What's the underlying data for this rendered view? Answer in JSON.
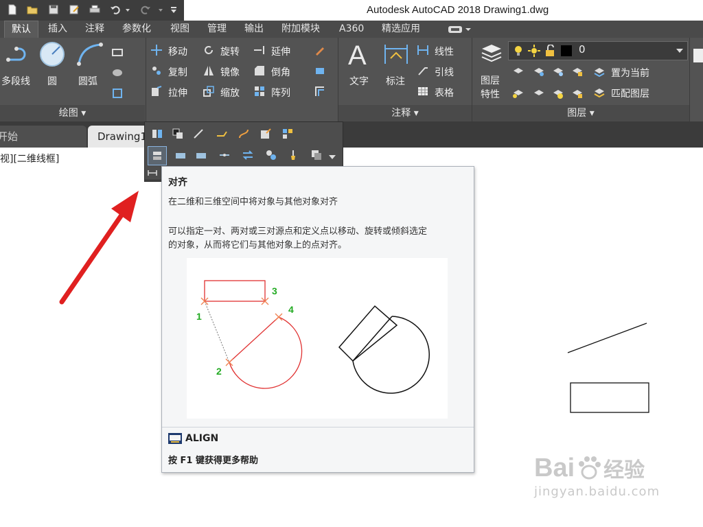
{
  "titlebar": {
    "app_title": "Autodesk AutoCAD 2018    Drawing1.dwg"
  },
  "ribbon_tabs": [
    "默认",
    "插入",
    "注释",
    "参数化",
    "视图",
    "管理",
    "输出",
    "附加模块",
    "A360",
    "精选应用"
  ],
  "draw_panel": {
    "polyline": "多段线",
    "circle": "圆",
    "arc": "圆弧",
    "footer": "绘图 ▾"
  },
  "modify_panel": {
    "move": "移动",
    "rotate": "旋转",
    "extend": "延伸",
    "copy": "复制",
    "mirror": "镜像",
    "chamfer": "倒角",
    "stretch": "拉伸",
    "scale": "缩放",
    "array": "阵列"
  },
  "annotation_panel": {
    "text": "文字",
    "dimension": "标注",
    "linear": "线性",
    "leader": "引线",
    "table": "表格",
    "footer": "注释 ▾"
  },
  "layers_panel": {
    "layer_properties_1": "图层",
    "layer_properties_2": "特性",
    "layer_value": "0",
    "set_current": "置为当前",
    "match_layer": "匹配图层",
    "footer": "图层 ▾"
  },
  "doc_tabs": {
    "start": "开始",
    "drawing": "Drawing1"
  },
  "viewport_label": "视][二维线框]",
  "tooltip": {
    "title": "对齐",
    "summary": "在二维和三维空间中将对象与其他对象对齐",
    "desc_line1": "可以指定一对、两对或三对源点和定义点以移动、旋转或倾斜选定",
    "desc_line2": "的对象，从而将它们与其他对象上的点对齐。",
    "label_1": "1",
    "label_2": "2",
    "label_3": "3",
    "label_4": "4",
    "command": "ALIGN",
    "help": "按 F1 键获得更多帮助"
  },
  "watermark": {
    "brand": "Bai",
    "brand2": "经验",
    "url": "jingyan.baidu.com"
  },
  "colors": {
    "ribbon": "#535353",
    "tab_bar": "#4a4a4a",
    "arrow": "#e02020",
    "diagram_red": "#e03030",
    "diagram_green": "#22aa22"
  }
}
